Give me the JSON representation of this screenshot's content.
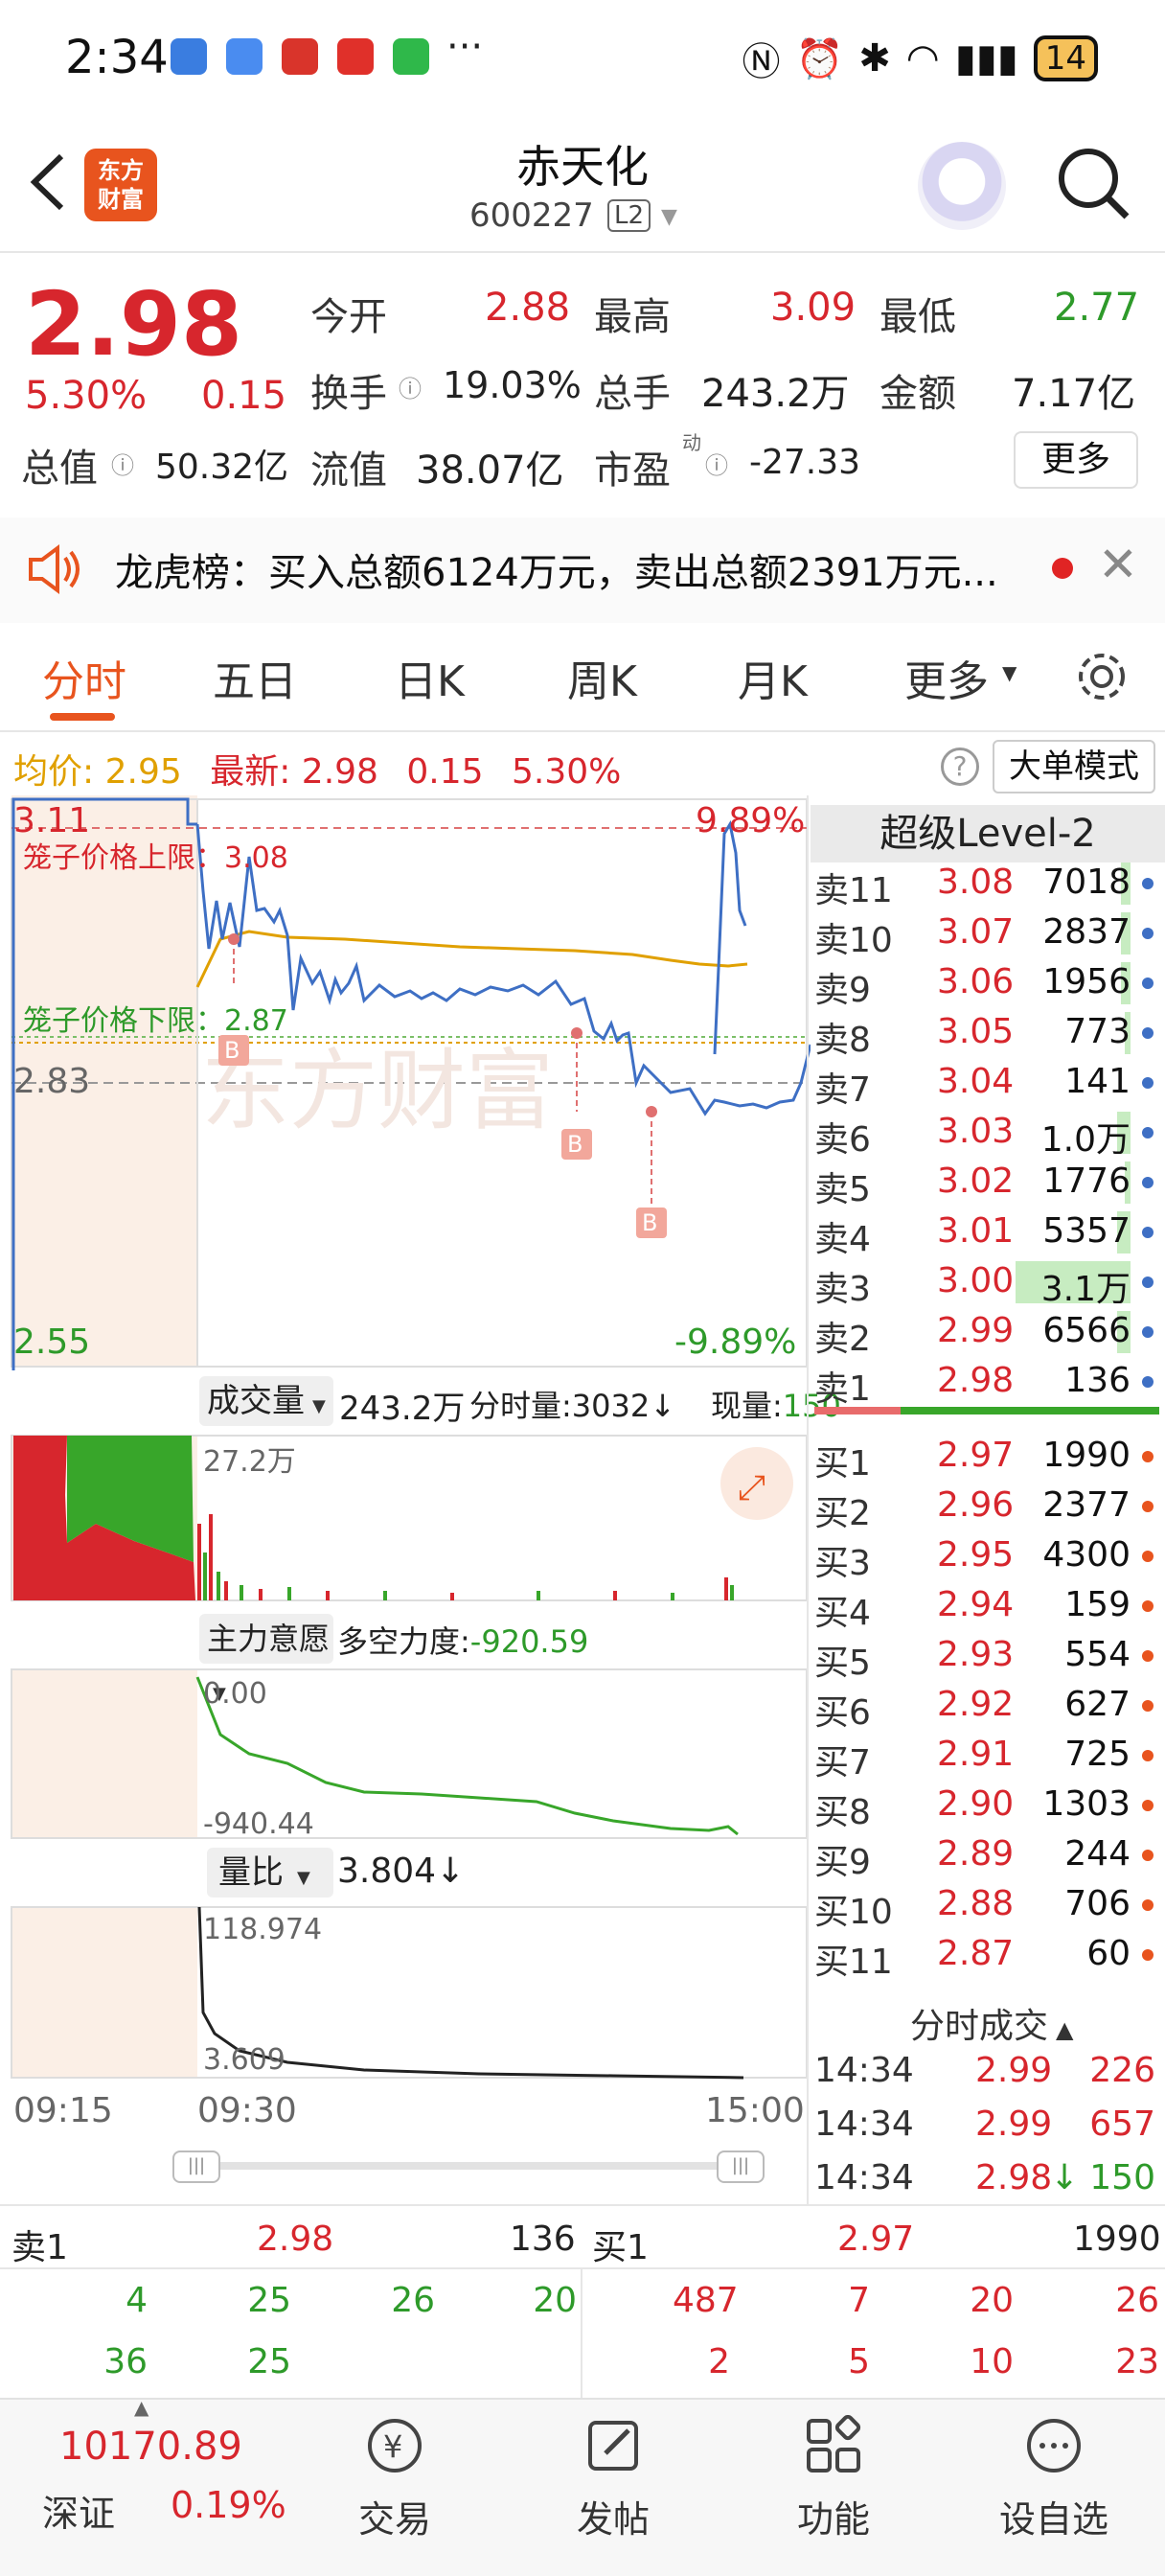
{
  "status_bar": {
    "time": "2:34",
    "battery": "14"
  },
  "header": {
    "stock_name": "赤天化",
    "stock_code": "600227",
    "level_badge": "L2",
    "logo_text_1": "东方",
    "logo_text_2": "财富"
  },
  "quote": {
    "price": "2.98",
    "pct": "5.30%",
    "change": "0.15",
    "open_label": "今开",
    "open": "2.88",
    "high_label": "最高",
    "high": "3.09",
    "low_label": "最低",
    "low": "2.77",
    "turnover_label": "换手",
    "turnover": "19.03%",
    "volume_label": "总手",
    "volume": "243.2万",
    "amount_label": "金额",
    "amount": "7.17亿",
    "mktcap_label": "总值",
    "mktcap": "50.32亿",
    "float_label": "流值",
    "float_cap": "38.07亿",
    "pe_label": "市盈",
    "pe_sup": "动",
    "pe": "-27.33",
    "more_label": "更多"
  },
  "notice": {
    "text": "龙虎榜：买入总额6124万元，卖出总额2391万元..."
  },
  "tabs": [
    "分时",
    "五日",
    "日K",
    "周K",
    "月K",
    "更多"
  ],
  "info_row": {
    "avg_label": "均价:",
    "avg": "2.95",
    "latest_label": "最新:",
    "latest": "2.98",
    "change": "0.15",
    "pct": "5.30%",
    "big_order_mode": "大单模式"
  },
  "chart": {
    "price_high": "3.11",
    "price_mid": "2.83",
    "price_low": "2.55",
    "pct_high": "9.89%",
    "pct_low": "-9.89%",
    "cage_upper": "笼子价格上限：3.08",
    "cage_lower": "笼子价格下限：2.87",
    "buy_marker": "B",
    "vol_selector": "成交量",
    "vol_total": "243.2万",
    "vol_tick": "分时量:3032↓",
    "vol_now_label": "现量:",
    "vol_now": "150",
    "vol_axis_max": "27.2万",
    "main_selector": "主力意愿",
    "force_label": "多空力度:",
    "force": "-920.59",
    "main_top": "0.00",
    "main_bottom": "-940.44",
    "ratio_selector": "量比",
    "ratio": "3.804↓",
    "ratio_top": "118.974",
    "ratio_bottom": "3.609",
    "time_start": "09:15",
    "time_open": "09:30",
    "time_end": "15:00",
    "watermark": "东方财富"
  },
  "level2": {
    "title": "超级Level-2",
    "asks": [
      {
        "label": "卖11",
        "price": "3.08",
        "vol": "7018"
      },
      {
        "label": "卖10",
        "price": "3.07",
        "vol": "2837"
      },
      {
        "label": "卖9",
        "price": "3.06",
        "vol": "1956"
      },
      {
        "label": "卖8",
        "price": "3.05",
        "vol": "773"
      },
      {
        "label": "卖7",
        "price": "3.04",
        "vol": "141"
      },
      {
        "label": "卖6",
        "price": "3.03",
        "vol": "1.0万"
      },
      {
        "label": "卖5",
        "price": "3.02",
        "vol": "1776"
      },
      {
        "label": "卖4",
        "price": "3.01",
        "vol": "5357"
      },
      {
        "label": "卖3",
        "price": "3.00",
        "vol": "3.1万"
      },
      {
        "label": "卖2",
        "price": "2.99",
        "vol": "6566"
      },
      {
        "label": "卖1",
        "price": "2.98",
        "vol": "136"
      }
    ],
    "bids": [
      {
        "label": "买1",
        "price": "2.97",
        "vol": "1990"
      },
      {
        "label": "买2",
        "price": "2.96",
        "vol": "2377"
      },
      {
        "label": "买3",
        "price": "2.95",
        "vol": "4300"
      },
      {
        "label": "买4",
        "price": "2.94",
        "vol": "159"
      },
      {
        "label": "买5",
        "price": "2.93",
        "vol": "554"
      },
      {
        "label": "买6",
        "price": "2.92",
        "vol": "627"
      },
      {
        "label": "买7",
        "price": "2.91",
        "vol": "725"
      },
      {
        "label": "买8",
        "price": "2.90",
        "vol": "1303"
      },
      {
        "label": "买9",
        "price": "2.89",
        "vol": "244"
      },
      {
        "label": "买10",
        "price": "2.88",
        "vol": "706"
      },
      {
        "label": "买11",
        "price": "2.87",
        "vol": "60"
      }
    ],
    "ticks_title": "分时成交",
    "ticks": [
      {
        "time": "14:34",
        "price": "2.99",
        "vol": "226",
        "arrow": ""
      },
      {
        "time": "14:34",
        "price": "2.99",
        "vol": "657",
        "arrow": ""
      },
      {
        "time": "14:34",
        "price": "2.98",
        "vol": "150",
        "arrow": "↓"
      }
    ]
  },
  "bottom_table": {
    "sell_label": "卖1",
    "sell_price": "2.98",
    "sell_vol": "136",
    "buy_label": "买1",
    "buy_price": "2.97",
    "buy_vol": "1990",
    "sell_row1": [
      "4",
      "25",
      "26",
      "20"
    ],
    "sell_row2": [
      "36",
      "25"
    ],
    "buy_row1": [
      "487",
      "7",
      "20",
      "26"
    ],
    "buy_row2": [
      "2",
      "5",
      "10",
      "23"
    ]
  },
  "index": {
    "value": "10170.89",
    "name": "深证",
    "pct": "0.19%"
  },
  "nav": [
    "交易",
    "发帖",
    "功能",
    "设自选"
  ]
}
